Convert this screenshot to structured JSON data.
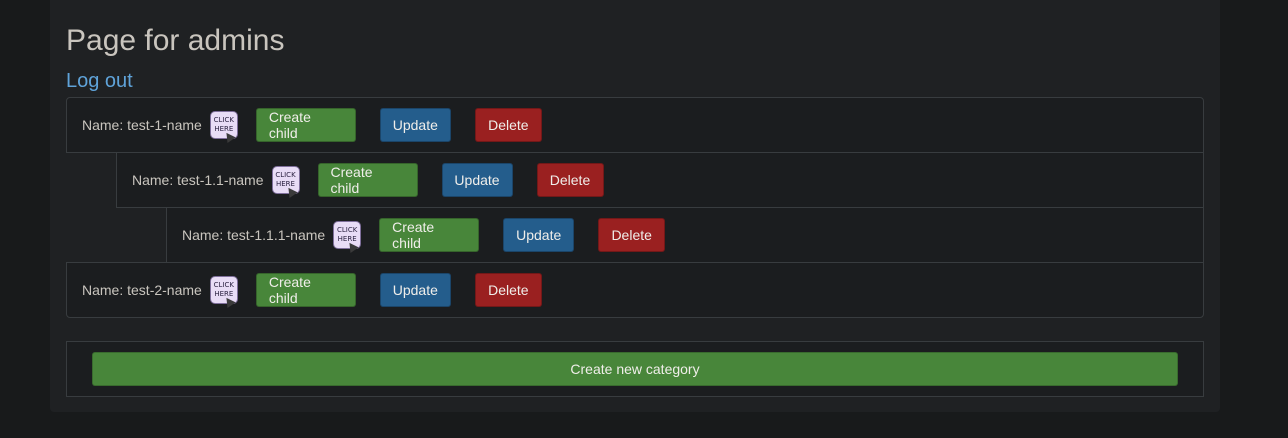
{
  "page": {
    "title": "Page for admins",
    "logout_label": "Log out"
  },
  "categories": [
    {
      "name": "Name: test-1-name",
      "click_line1": "CLICK",
      "click_line2": "HERE",
      "create_child": "Create child",
      "update": "Update",
      "delete": "Delete"
    },
    {
      "name": "Name: test-1.1-name",
      "click_line1": "CLICK",
      "click_line2": "HERE",
      "create_child": "Create child",
      "update": "Update",
      "delete": "Delete"
    },
    {
      "name": "Name: test-1.1.1-name",
      "click_line1": "CLICK",
      "click_line2": "HERE",
      "create_child": "Create child",
      "update": "Update",
      "delete": "Delete"
    },
    {
      "name": "Name: test-2-name",
      "click_line1": "CLICK",
      "click_line2": "HERE",
      "create_child": "Create child",
      "update": "Update",
      "delete": "Delete"
    }
  ],
  "create_category_label": "Create new category",
  "colors": {
    "success": "#48863a",
    "primary": "#245d8c",
    "danger": "#9a2020",
    "link": "#5fa3d9"
  }
}
